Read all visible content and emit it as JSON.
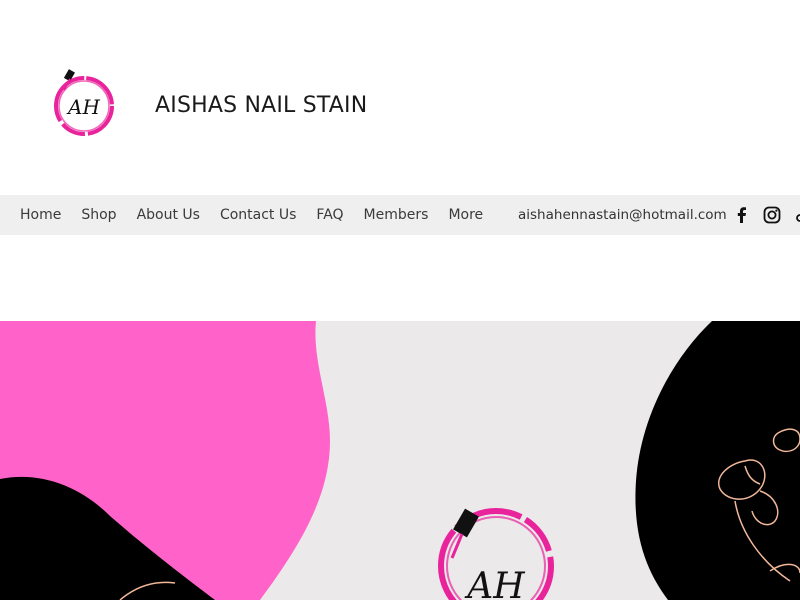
{
  "header": {
    "site_title": "AISHAS NAIL STAIN",
    "logo_initials": "AH",
    "brand_color": "#e9239b"
  },
  "nav": {
    "items": [
      {
        "label": "Home"
      },
      {
        "label": "Shop"
      },
      {
        "label": "About Us"
      },
      {
        "label": "Contact Us"
      },
      {
        "label": "FAQ"
      },
      {
        "label": "Members"
      },
      {
        "label": "More"
      }
    ],
    "email": "aishahennastain@hotmail.com",
    "social_icons": [
      "facebook-icon",
      "instagram-icon",
      "tiktok-icon"
    ]
  },
  "hero": {
    "colors": {
      "pink": "#ff63c9",
      "black": "#000000",
      "background": "#ebe9e9",
      "floral_line": "#f2b89a"
    },
    "logo_initials": "AH"
  }
}
